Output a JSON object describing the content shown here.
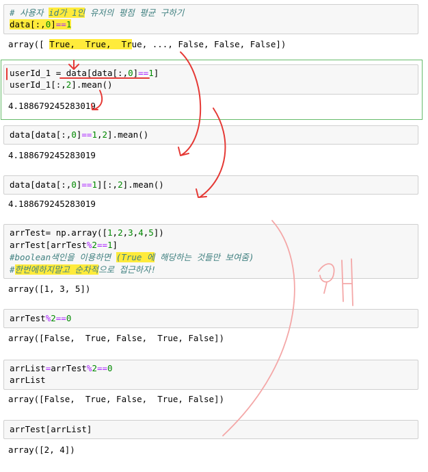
{
  "cells": [
    {
      "id": "c1",
      "lines": [
        [
          {
            "t": "# 사용자 ",
            "c": "com"
          },
          {
            "t": "id가 1인",
            "c": "com hl"
          },
          {
            "t": " 유저의 평점 평균 구하기",
            "c": "com"
          }
        ],
        [
          {
            "t": "data[:,",
            "c": "hl"
          },
          {
            "t": "0",
            "c": "num hl"
          },
          {
            "t": "]",
            "c": "hl"
          },
          {
            "t": "==",
            "c": "op hl"
          },
          {
            "t": "1",
            "c": "num hl"
          }
        ]
      ],
      "output": [
        [
          {
            "t": "array([ "
          },
          {
            "t": "True,  True,  Tr",
            "c": "hl"
          },
          {
            "t": "ue, ..., False, False, False])"
          }
        ]
      ]
    },
    {
      "id": "c2",
      "lines": [
        [
          {
            "t": "userId_1 = data[data[:,"
          },
          {
            "t": "0",
            "c": "num"
          },
          {
            "t": "]"
          },
          {
            "t": "==",
            "c": "op"
          },
          {
            "t": "1",
            "c": "num"
          },
          {
            "t": "]"
          }
        ],
        [
          {
            "t": "userId_1[:,"
          },
          {
            "t": "2",
            "c": "num"
          },
          {
            "t": "].mean()"
          }
        ]
      ],
      "output": [
        [
          {
            "t": "4.188679245283019"
          }
        ]
      ]
    },
    {
      "id": "c3",
      "lines": [
        [
          {
            "t": "data[data[:,"
          },
          {
            "t": "0",
            "c": "num"
          },
          {
            "t": "]"
          },
          {
            "t": "==",
            "c": "op"
          },
          {
            "t": "1",
            "c": "num"
          },
          {
            "t": ","
          },
          {
            "t": "2",
            "c": "num"
          },
          {
            "t": "].mean()"
          }
        ]
      ],
      "output": [
        [
          {
            "t": "4.188679245283019"
          }
        ]
      ]
    },
    {
      "id": "c4",
      "lines": [
        [
          {
            "t": "data[data[:,"
          },
          {
            "t": "0",
            "c": "num"
          },
          {
            "t": "]"
          },
          {
            "t": "==",
            "c": "op"
          },
          {
            "t": "1",
            "c": "num"
          },
          {
            "t": "][:,"
          },
          {
            "t": "2",
            "c": "num"
          },
          {
            "t": "].mean()"
          }
        ]
      ],
      "output": [
        [
          {
            "t": "4.188679245283019"
          }
        ]
      ]
    },
    {
      "id": "c5",
      "lines": [
        [
          {
            "t": "arrTest= np.array(["
          },
          {
            "t": "1",
            "c": "num"
          },
          {
            "t": ","
          },
          {
            "t": "2",
            "c": "num"
          },
          {
            "t": ","
          },
          {
            "t": "3",
            "c": "num"
          },
          {
            "t": ","
          },
          {
            "t": "4",
            "c": "num"
          },
          {
            "t": ","
          },
          {
            "t": "5",
            "c": "num"
          },
          {
            "t": "])"
          }
        ],
        [
          {
            "t": "arrTest[arrTest"
          },
          {
            "t": "%",
            "c": "op"
          },
          {
            "t": "2",
            "c": "num"
          },
          {
            "t": "==",
            "c": "op"
          },
          {
            "t": "1",
            "c": "num"
          },
          {
            "t": "]"
          }
        ],
        [
          {
            "t": "#boolean색인을 이용하면 ",
            "c": "com"
          },
          {
            "t": "(True 에",
            "c": "com hl"
          },
          {
            "t": " 해당하는 것들만 보여줌)",
            "c": "com"
          }
        ],
        [
          {
            "t": "#",
            "c": "com"
          },
          {
            "t": "한번에하지말고 순차적",
            "c": "com hl"
          },
          {
            "t": "으로 접근하자!",
            "c": "com"
          }
        ]
      ],
      "output": [
        [
          {
            "t": "array([1, 3, 5])"
          }
        ]
      ]
    },
    {
      "id": "c6",
      "lines": [
        [
          {
            "t": "arrTest"
          },
          {
            "t": "%",
            "c": "op"
          },
          {
            "t": "2",
            "c": "num"
          },
          {
            "t": "==",
            "c": "op"
          },
          {
            "t": "0",
            "c": "num"
          }
        ]
      ],
      "output": [
        [
          {
            "t": "array([False,  True, False,  True, False])"
          }
        ]
      ]
    },
    {
      "id": "c7",
      "lines": [
        [
          {
            "t": "arrList"
          },
          {
            "t": "=",
            "c": "op"
          },
          {
            "t": "arrTest"
          },
          {
            "t": "%",
            "c": "op"
          },
          {
            "t": "2",
            "c": "num"
          },
          {
            "t": "==",
            "c": "op"
          },
          {
            "t": "0",
            "c": "num"
          }
        ],
        [
          {
            "t": "arrList"
          }
        ]
      ],
      "output": [
        [
          {
            "t": "array([False,  True, False,  True, False])"
          }
        ]
      ]
    },
    {
      "id": "c8",
      "lines": [
        [
          {
            "t": "arrTest[arrList]"
          }
        ]
      ],
      "output": [
        [
          {
            "t": "array([2, 4])"
          }
        ]
      ]
    }
  ],
  "annotation_colors": {
    "ink": "#e53935",
    "pencil": "#f4a7a7",
    "highlight": "#ffeb3b"
  }
}
